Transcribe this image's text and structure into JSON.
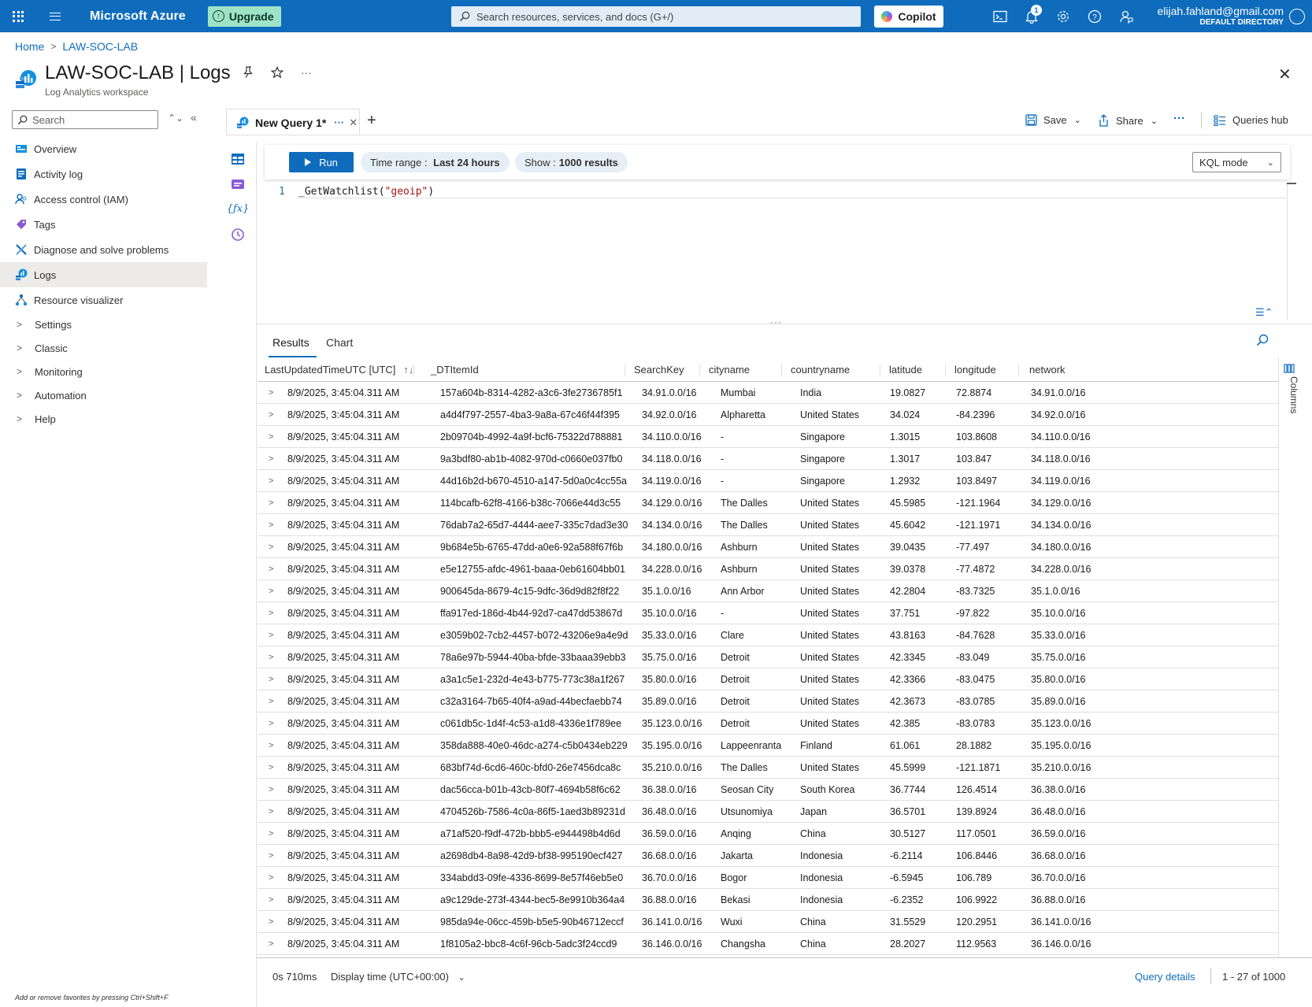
{
  "topbar": {
    "brand": "Microsoft Azure",
    "upgrade_label": "Upgrade",
    "search_placeholder": "Search resources, services, and docs (G+/)",
    "copilot_label": "Copilot",
    "notification_count": "1",
    "account_email": "elijah.fahland@gmail.com",
    "account_directory": "DEFAULT DIRECTORY",
    "brand_color": "#0f6cbd"
  },
  "breadcrumb": [
    "Home",
    "LAW-SOC-LAB"
  ],
  "header": {
    "title": "LAW-SOC-LAB | Logs",
    "subtitle": "Log Analytics workspace"
  },
  "sidebar": {
    "search_placeholder": "Search",
    "items": [
      {
        "label": "Overview",
        "icon": "overview-icon"
      },
      {
        "label": "Activity log",
        "icon": "activity-log-icon"
      },
      {
        "label": "Access control (IAM)",
        "icon": "iam-icon"
      },
      {
        "label": "Tags",
        "icon": "tag-icon"
      },
      {
        "label": "Diagnose and solve problems",
        "icon": "wrench-icon"
      },
      {
        "label": "Logs",
        "icon": "logs-icon",
        "active": true
      },
      {
        "label": "Resource visualizer",
        "icon": "visualizer-icon"
      }
    ],
    "groups": [
      "Settings",
      "Classic",
      "Monitoring",
      "Automation",
      "Help"
    ],
    "favorites_hint": "Add or remove favorites by pressing Ctrl+Shift+F"
  },
  "query_tab": {
    "label": "New Query 1*",
    "more": "···",
    "add": "+"
  },
  "toolbar": {
    "save_label": "Save",
    "share_label": "Share",
    "more": "···",
    "queries_hub_label": "Queries hub"
  },
  "query_bar": {
    "run_label": "Run",
    "time_range_prefix": "Time range :",
    "time_range_value": "Last 24 hours",
    "show_prefix": "Show :",
    "show_value": "1000 results",
    "mode": "KQL mode"
  },
  "editor": {
    "line_number": "1",
    "code_fn": "_GetWatchlist(",
    "code_str": "\"geoip\"",
    "code_end": ")"
  },
  "results": {
    "tabs": [
      "Results",
      "Chart"
    ],
    "columns": [
      "LastUpdatedTimeUTC [UTC]",
      "_DTItemId",
      "SearchKey",
      "cityname",
      "countryname",
      "latitude",
      "longitude",
      "network"
    ],
    "columns_panel_label": "Columns",
    "rows": [
      [
        "8/9/2025, 3:45:04.311 AM",
        "157a604b-8314-4282-a3c6-3fe2736785f1",
        "34.91.0.0/16",
        "Mumbai",
        "India",
        "19.0827",
        "72.8874",
        "34.91.0.0/16"
      ],
      [
        "8/9/2025, 3:45:04.311 AM",
        "a4d4f797-2557-4ba3-9a8a-67c46f44f395",
        "34.92.0.0/16",
        "Alpharetta",
        "United States",
        "34.024",
        "-84.2396",
        "34.92.0.0/16"
      ],
      [
        "8/9/2025, 3:45:04.311 AM",
        "2b09704b-4992-4a9f-bcf6-75322d788881",
        "34.110.0.0/16",
        "-",
        "Singapore",
        "1.3015",
        "103.8608",
        "34.110.0.0/16"
      ],
      [
        "8/9/2025, 3:45:04.311 AM",
        "9a3bdf80-ab1b-4082-970d-c0660e037fb0",
        "34.118.0.0/16",
        "-",
        "Singapore",
        "1.3017",
        "103.847",
        "34.118.0.0/16"
      ],
      [
        "8/9/2025, 3:45:04.311 AM",
        "44d16b2d-b670-4510-a147-5d0a0c4cc55a",
        "34.119.0.0/16",
        "-",
        "Singapore",
        "1.2932",
        "103.8497",
        "34.119.0.0/16"
      ],
      [
        "8/9/2025, 3:45:04.311 AM",
        "114bcafb-62f8-4166-b38c-7066e44d3c55",
        "34.129.0.0/16",
        "The Dalles",
        "United States",
        "45.5985",
        "-121.1964",
        "34.129.0.0/16"
      ],
      [
        "8/9/2025, 3:45:04.311 AM",
        "76dab7a2-65d7-4444-aee7-335c7dad3e30",
        "34.134.0.0/16",
        "The Dalles",
        "United States",
        "45.6042",
        "-121.1971",
        "34.134.0.0/16"
      ],
      [
        "8/9/2025, 3:45:04.311 AM",
        "9b684e5b-6765-47dd-a0e6-92a588f67f6b",
        "34.180.0.0/16",
        "Ashburn",
        "United States",
        "39.0435",
        "-77.497",
        "34.180.0.0/16"
      ],
      [
        "8/9/2025, 3:45:04.311 AM",
        "e5e12755-afdc-4961-baaa-0eb61604bb01",
        "34.228.0.0/16",
        "Ashburn",
        "United States",
        "39.0378",
        "-77.4872",
        "34.228.0.0/16"
      ],
      [
        "8/9/2025, 3:45:04.311 AM",
        "900645da-8679-4c15-9dfc-36d9d82f8f22",
        "35.1.0.0/16",
        "Ann Arbor",
        "United States",
        "42.2804",
        "-83.7325",
        "35.1.0.0/16"
      ],
      [
        "8/9/2025, 3:45:04.311 AM",
        "ffa917ed-186d-4b44-92d7-ca47dd53867d",
        "35.10.0.0/16",
        "-",
        "United States",
        "37.751",
        "-97.822",
        "35.10.0.0/16"
      ],
      [
        "8/9/2025, 3:45:04.311 AM",
        "e3059b02-7cb2-4457-b072-43206e9a4e9d",
        "35.33.0.0/16",
        "Clare",
        "United States",
        "43.8163",
        "-84.7628",
        "35.33.0.0/16"
      ],
      [
        "8/9/2025, 3:45:04.311 AM",
        "78a6e97b-5944-40ba-bfde-33baaa39ebb3",
        "35.75.0.0/16",
        "Detroit",
        "United States",
        "42.3345",
        "-83.049",
        "35.75.0.0/16"
      ],
      [
        "8/9/2025, 3:45:04.311 AM",
        "a3a1c5e1-232d-4e43-b775-773c38a1f267",
        "35.80.0.0/16",
        "Detroit",
        "United States",
        "42.3366",
        "-83.0475",
        "35.80.0.0/16"
      ],
      [
        "8/9/2025, 3:45:04.311 AM",
        "c32a3164-7b65-40f4-a9ad-44becfaebb74",
        "35.89.0.0/16",
        "Detroit",
        "United States",
        "42.3673",
        "-83.0785",
        "35.89.0.0/16"
      ],
      [
        "8/9/2025, 3:45:04.311 AM",
        "c061db5c-1d4f-4c53-a1d8-4336e1f789ee",
        "35.123.0.0/16",
        "Detroit",
        "United States",
        "42.385",
        "-83.0783",
        "35.123.0.0/16"
      ],
      [
        "8/9/2025, 3:45:04.311 AM",
        "358da888-40e0-46dc-a274-c5b0434eb229",
        "35.195.0.0/16",
        "Lappeenranta",
        "Finland",
        "61.061",
        "28.1882",
        "35.195.0.0/16"
      ],
      [
        "8/9/2025, 3:45:04.311 AM",
        "683bf74d-6cd6-460c-bfd0-26e7456dca8c",
        "35.210.0.0/16",
        "The Dalles",
        "United States",
        "45.5999",
        "-121.1871",
        "35.210.0.0/16"
      ],
      [
        "8/9/2025, 3:45:04.311 AM",
        "dac56cca-b01b-43cb-80f7-4694b58f6c62",
        "36.38.0.0/16",
        "Seosan City",
        "South Korea",
        "36.7744",
        "126.4514",
        "36.38.0.0/16"
      ],
      [
        "8/9/2025, 3:45:04.311 AM",
        "4704526b-7586-4c0a-86f5-1aed3b89231d",
        "36.48.0.0/16",
        "Utsunomiya",
        "Japan",
        "36.5701",
        "139.8924",
        "36.48.0.0/16"
      ],
      [
        "8/9/2025, 3:45:04.311 AM",
        "a71af520-f9df-472b-bbb5-e944498b4d6d",
        "36.59.0.0/16",
        "Anqing",
        "China",
        "30.5127",
        "117.0501",
        "36.59.0.0/16"
      ],
      [
        "8/9/2025, 3:45:04.311 AM",
        "a2698db4-8a98-42d9-bf38-995190ecf427",
        "36.68.0.0/16",
        "Jakarta",
        "Indonesia",
        "-6.2114",
        "106.8446",
        "36.68.0.0/16"
      ],
      [
        "8/9/2025, 3:45:04.311 AM",
        "334abdd3-09fe-4336-8699-8e57f46eb5e0",
        "36.70.0.0/16",
        "Bogor",
        "Indonesia",
        "-6.5945",
        "106.789",
        "36.70.0.0/16"
      ],
      [
        "8/9/2025, 3:45:04.311 AM",
        "a9c129de-273f-4344-bec5-8e9910b364a4",
        "36.88.0.0/16",
        "Bekasi",
        "Indonesia",
        "-6.2352",
        "106.9922",
        "36.88.0.0/16"
      ],
      [
        "8/9/2025, 3:45:04.311 AM",
        "985da94e-06cc-459b-b5e5-90b46712eccf",
        "36.141.0.0/16",
        "Wuxi",
        "China",
        "31.5529",
        "120.2951",
        "36.141.0.0/16"
      ],
      [
        "8/9/2025, 3:45:04.311 AM",
        "1f8105a2-bbc8-4c6f-96cb-5adc3f24ccd9",
        "36.146.0.0/16",
        "Changsha",
        "China",
        "28.2027",
        "112.9563",
        "36.146.0.0/16"
      ]
    ]
  },
  "footer": {
    "duration": "0s 710ms",
    "display_time": "Display time (UTC+00:00)",
    "query_details": "Query details",
    "range": "1 - 27 of 1000"
  }
}
